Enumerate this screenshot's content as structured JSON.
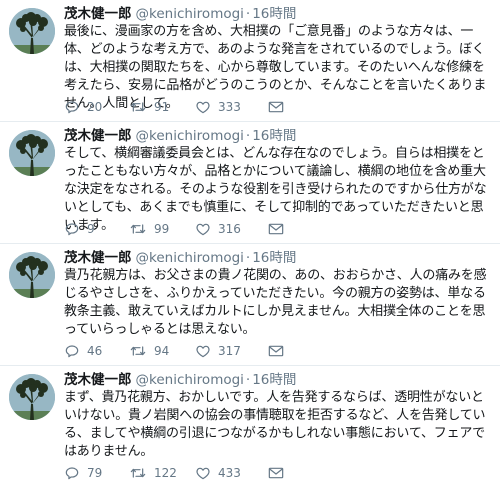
{
  "tweets": [
    {
      "name": "茂木健一郎",
      "handle": "@kenichiromogi",
      "dot": "·",
      "time": "16時間",
      "text": "最後に、漫画家の方を含め、大相撲の「ご意見番」のような方々は、一体、どのような考え方で、あのような発言をされているのでしょう。ぼくは、大相撲の関取たちを、心から尊敬しています。そのたいへんな修練を考えたら、安易に品格がどうのこうのとか、そんなことを言いたくありません。人間として。",
      "replies": "20",
      "retweets": "91",
      "likes": "333"
    },
    {
      "name": "茂木健一郎",
      "handle": "@kenichiromogi",
      "dot": "·",
      "time": "16時間",
      "text": "そして、横綱審議委員会とは、どんな存在なのでしょう。自らは相撲をとったこともない方々が、品格とかについて議論し、横綱の地位を含め重大な決定をなされる。そのような役割を引き受けられたのですから仕方がないとしても、あくまでも慎重に、そして抑制的であっていただきたいと思います。",
      "replies": "9",
      "retweets": "99",
      "likes": "316"
    },
    {
      "name": "茂木健一郎",
      "handle": "@kenichiromogi",
      "dot": "·",
      "time": "16時間",
      "text": "貴乃花親方は、お父さまの貴ノ花関の、あの、おおらかさ、人の痛みを感じるやさしさを、ふりかえっていただきたい。今の親方の姿勢は、単なる教条主義、敢えていえばカルトにしか見えません。大相撲全体のことを思っていらっしゃるとは思えない。",
      "replies": "46",
      "retweets": "94",
      "likes": "317"
    },
    {
      "name": "茂木健一郎",
      "handle": "@kenichiromogi",
      "dot": "·",
      "time": "16時間",
      "text": "まず、貴乃花親方、おかしいです。人を告発するならば、透明性がないといけない。貴ノ岩関への協会の事情聴取を拒否するなど、人を告発している、ましてや横綱の引退につながるかもしれない事態において、フェアではありません。",
      "replies": "79",
      "retweets": "122",
      "likes": "433"
    }
  ],
  "icons": {
    "avatar": "avatar-tree-silhouette",
    "reply": "reply-icon",
    "retweet": "retweet-icon",
    "like": "heart-icon",
    "message": "envelope-icon"
  },
  "colors": {
    "name": "#14171a",
    "meta": "#657786",
    "divider": "#e6ecf0",
    "avatar_bg": "#97b7c4",
    "avatar_tree": "#23301f"
  }
}
